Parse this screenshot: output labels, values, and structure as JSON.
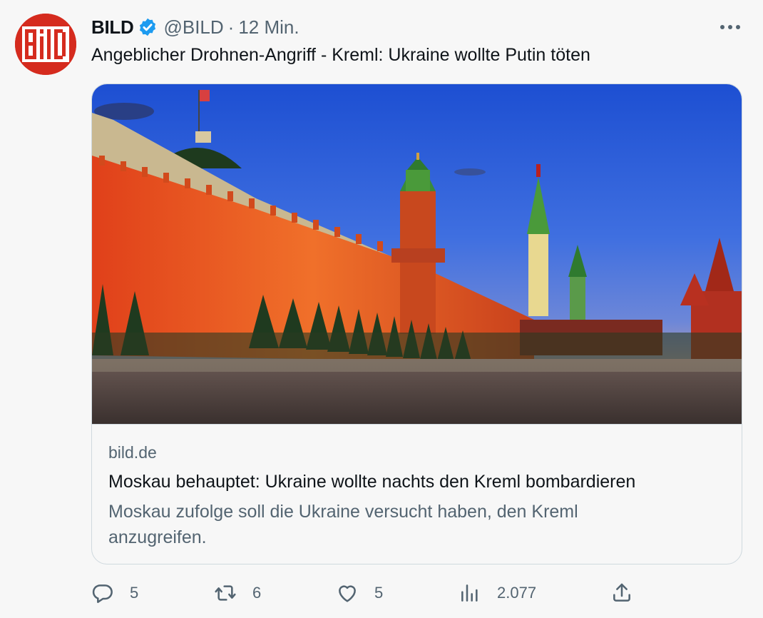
{
  "tweet": {
    "author_name": "BILD",
    "handle": "@BILD",
    "separator": "·",
    "time": "12 Min.",
    "text": "Angeblicher Drohnen-Angriff - Kreml: Ukraine wollte Putin töten",
    "avatar_logo_text": "Bild"
  },
  "card": {
    "domain": "bild.de",
    "title": "Moskau behauptet: Ukraine wollte nachts den Kreml bombardieren",
    "description": "Moskau zufolge soll die Ukraine versucht haben, den Kreml anzugreifen."
  },
  "actions": {
    "replies": "5",
    "retweets": "6",
    "likes": "5",
    "views": "2.077"
  },
  "icons": {
    "verified": "verified-badge-icon",
    "more": "more-dots-icon",
    "reply": "reply-bubble-icon",
    "retweet": "retweet-arrows-icon",
    "like": "heart-icon",
    "views": "bar-chart-icon",
    "share": "share-upload-icon"
  },
  "colors": {
    "brand_red": "#d52b1e",
    "verified_blue": "#1d9bf0",
    "secondary_text": "#536471",
    "primary_text": "#0f1419",
    "border": "#cfd9de",
    "background": "#f7f7f7"
  }
}
